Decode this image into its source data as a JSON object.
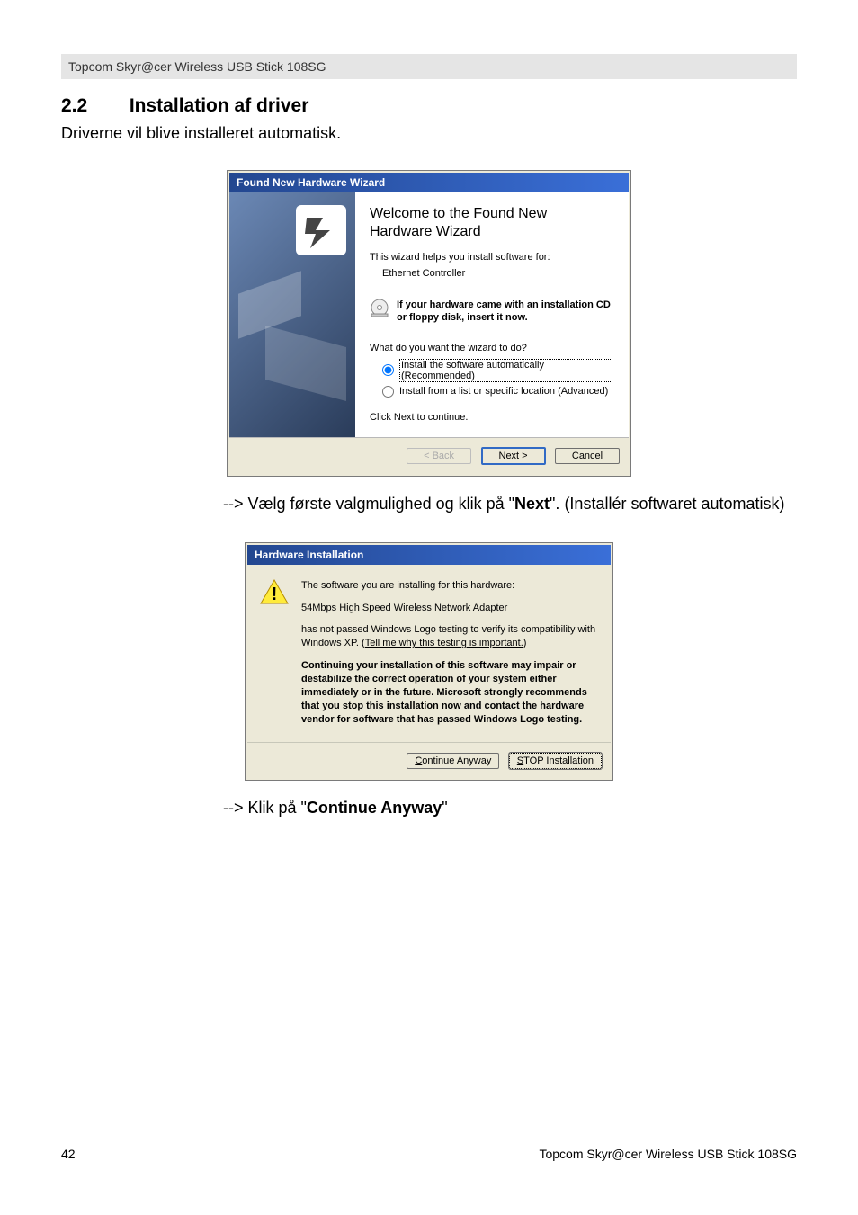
{
  "header": {
    "product": "Topcom Skyr@cer Wireless USB Stick 108SG"
  },
  "section": {
    "number": "2.2",
    "title": "Installation af driver",
    "intro": "Driverne vil blive installeret automatisk."
  },
  "wizard": {
    "titlebar": "Found New Hardware Wizard",
    "heading": "Welcome to the Found New Hardware Wizard",
    "helps": "This wizard helps you install software for:",
    "device": "Ethernet Controller",
    "cd_text": "If your hardware came with an installation CD or floppy disk, insert it now.",
    "what_do": "What do you want the wizard to do?",
    "radio1": "Install the software automatically (Recommended)",
    "radio2": "Install from a list or specific location (Advanced)",
    "click_next": "Click Next to continue.",
    "back": "Back",
    "next": "Next >",
    "cancel": "Cancel"
  },
  "instruction1": {
    "prefix": "--> Vælg første valgmulighed og klik på \"",
    "bold": "Next",
    "suffix": "\".  (Installér softwaret automatisk)"
  },
  "hwdlg": {
    "titlebar": "Hardware Installation",
    "line1": "The software you are installing for this hardware:",
    "line2": "54Mbps High Speed Wireless Network Adapter",
    "line3a": "has not passed Windows Logo testing to verify its compatibility with Windows XP. (",
    "link": "Tell me why this testing is important.",
    "line3b": ")",
    "warn": "Continuing your installation of this software may impair or destabilize the correct operation of your system either immediately or in the future. Microsoft strongly recommends that you stop this installation now and contact the hardware vendor for software that has passed Windows Logo testing.",
    "continue": "Continue Anyway",
    "stop": "STOP Installation"
  },
  "instruction2": {
    "prefix": "--> Klik på \"",
    "bold": "Continue Anyway",
    "suffix": "\""
  },
  "footer": {
    "pagenum": "42",
    "product": "Topcom Skyr@cer Wireless USB Stick 108SG"
  }
}
